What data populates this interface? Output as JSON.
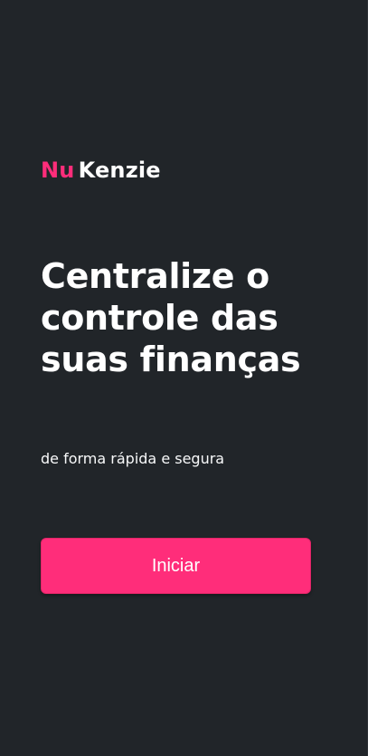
{
  "logo": {
    "part1": "Nu",
    "part2": "Kenzie"
  },
  "hero": {
    "headline": "Centralize o controle das suas finanças",
    "subtitle": "de forma rápida e segura"
  },
  "actions": {
    "start_label": "Iniciar"
  },
  "colors": {
    "background": "#212529",
    "brand_pink": "#ff2d7a",
    "text": "#ffffff"
  }
}
